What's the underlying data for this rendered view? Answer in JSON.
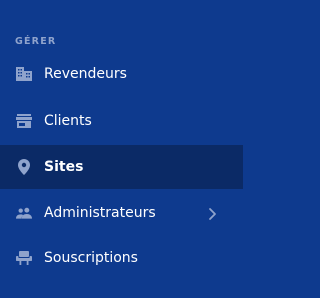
{
  "sidebar": {
    "section_label": "GÉRER",
    "items": [
      {
        "label": "Revendeurs",
        "icon": "building-icon",
        "active": false
      },
      {
        "label": "Clients",
        "icon": "store-icon",
        "active": false
      },
      {
        "label": "Sites",
        "icon": "location-pin-icon",
        "active": true
      },
      {
        "label": "Administrateurs",
        "icon": "people-icon",
        "active": false,
        "has_submenu": true
      },
      {
        "label": "Souscriptions",
        "icon": "seat-icon",
        "active": false
      }
    ]
  },
  "colors": {
    "background": "#0e3a8e",
    "active_background": "#0b2a66",
    "icon": "#8fa3cc",
    "text": "#ffffff",
    "section_label": "#8fa3cc"
  }
}
